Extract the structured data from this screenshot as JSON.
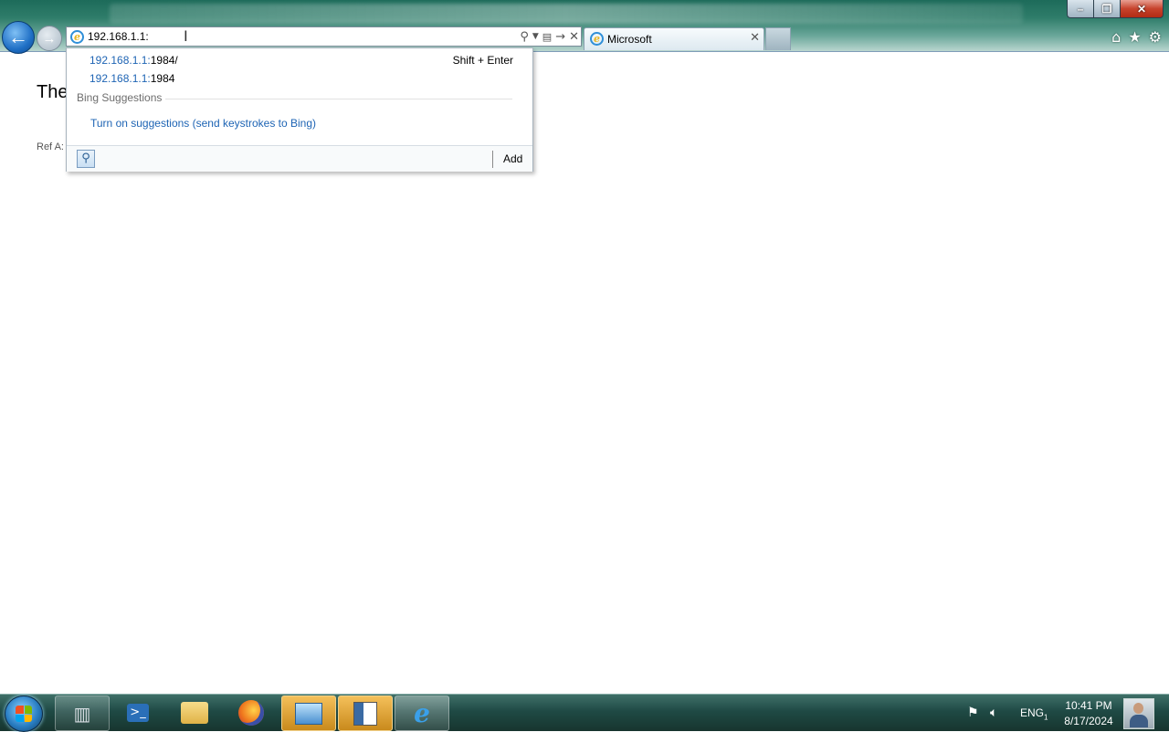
{
  "browser": {
    "address": "192.168.1.1:",
    "tab": {
      "title": "Microsoft"
    },
    "icons": {
      "back": "back-arrow-icon",
      "forward": "forward-arrow-icon",
      "search": "search-icon",
      "dropdown": "dropdown-arrow-icon",
      "compat": "compatibility-view-icon",
      "go": "go-arrow-icon",
      "stop": "stop-icon",
      "home": "home-icon",
      "favorites": "star-icon",
      "tools": "gear-icon"
    }
  },
  "window_controls": {
    "minimize": "minimize-icon",
    "maximize": "restore-icon",
    "close": "close-icon"
  },
  "page": {
    "heading": "The",
    "ref": "Ref A:"
  },
  "dropdown": {
    "suggestions": [
      {
        "host": "192.168.1.1:",
        "rest": "1984/"
      },
      {
        "host": "192.168.1.1:",
        "rest": "1984"
      }
    ],
    "hint": "Shift + Enter",
    "section_title": "Bing Suggestions",
    "bing_link": "Turn on suggestions (send keystrokes to Bing)",
    "add_label": "Add"
  },
  "taskbar": {
    "apps": [
      "start-orb",
      "server-manager",
      "powershell",
      "file-explorer",
      "firefox",
      "control-panel",
      "notepad",
      "internet-explorer"
    ],
    "language": "ENG",
    "language_sub": "1",
    "time": "10:41 PM",
    "date": "8/17/2024"
  },
  "colors": {
    "link": "#1e64b4",
    "accent": "#2f7d6a",
    "close_button": "#c7432c"
  }
}
